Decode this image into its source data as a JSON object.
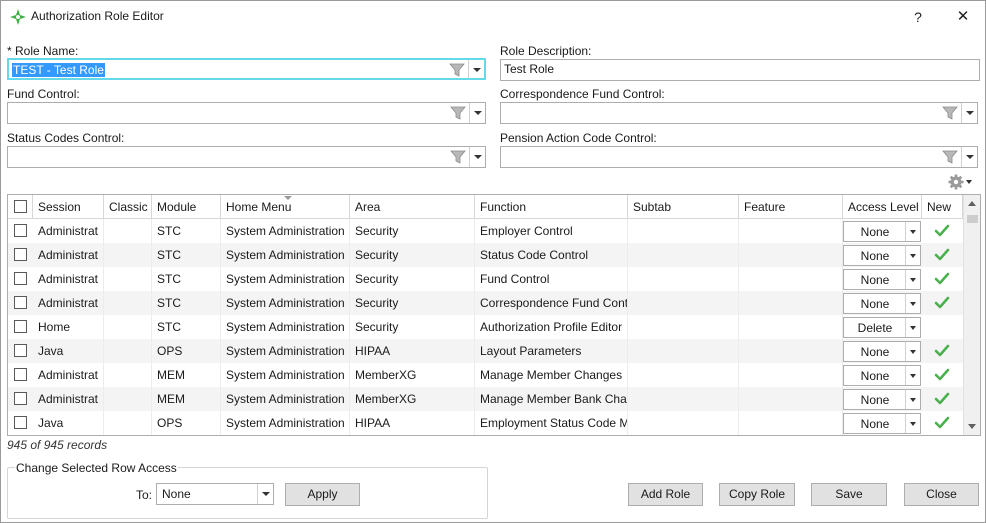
{
  "window": {
    "title": "Authorization Role Editor",
    "help_label": "?",
    "close_label": "✕"
  },
  "form": {
    "role_name_label": "* Role Name:",
    "role_name_value": "TEST - Test Role",
    "role_description_label": "Role Description:",
    "role_description_value": "Test Role",
    "fund_control_label": "Fund Control:",
    "fund_control_value": "",
    "correspondence_fund_control_label": "Correspondence Fund Control:",
    "correspondence_fund_control_value": "",
    "status_codes_control_label": "Status Codes Control:",
    "status_codes_control_value": "",
    "pension_action_code_control_label": "Pension Action Code Control:",
    "pension_action_code_control_value": ""
  },
  "grid": {
    "columns": [
      "Session",
      "Classic",
      "Module",
      "Home Menu",
      "Area",
      "Function",
      "Subtab",
      "Feature",
      "Access Level",
      "New"
    ],
    "rows": [
      {
        "session": "Administrat",
        "classic": "",
        "module": "STC",
        "home_menu": "System Administration",
        "area": "Security",
        "function": "Employer Control",
        "subtab": "",
        "feature": "",
        "access": "None",
        "new": true
      },
      {
        "session": "Administrat",
        "classic": "",
        "module": "STC",
        "home_menu": "System Administration",
        "area": "Security",
        "function": "Status Code Control",
        "subtab": "",
        "feature": "",
        "access": "None",
        "new": true
      },
      {
        "session": "Administrat",
        "classic": "",
        "module": "STC",
        "home_menu": "System Administration",
        "area": "Security",
        "function": "Fund Control",
        "subtab": "",
        "feature": "",
        "access": "None",
        "new": true
      },
      {
        "session": "Administrat",
        "classic": "",
        "module": "STC",
        "home_menu": "System Administration",
        "area": "Security",
        "function": "Correspondence Fund Cont",
        "subtab": "",
        "feature": "",
        "access": "None",
        "new": true
      },
      {
        "session": "Home",
        "classic": "",
        "module": "STC",
        "home_menu": "System Administration",
        "area": "Security",
        "function": "Authorization Profile Editor",
        "subtab": "",
        "feature": "",
        "access": "Delete",
        "new": false
      },
      {
        "session": "Java",
        "classic": "",
        "module": "OPS",
        "home_menu": "System Administration",
        "area": "HIPAA",
        "function": "Layout Parameters",
        "subtab": "",
        "feature": "",
        "access": "None",
        "new": true
      },
      {
        "session": "Administrat",
        "classic": "",
        "module": "MEM",
        "home_menu": "System Administration",
        "area": "MemberXG",
        "function": "Manage Member Changes",
        "subtab": "",
        "feature": "",
        "access": "None",
        "new": true
      },
      {
        "session": "Administrat",
        "classic": "",
        "module": "MEM",
        "home_menu": "System Administration",
        "area": "MemberXG",
        "function": "Manage Member Bank Cha",
        "subtab": "",
        "feature": "",
        "access": "None",
        "new": true
      },
      {
        "session": "Java",
        "classic": "",
        "module": "OPS",
        "home_menu": "System Administration",
        "area": "HIPAA",
        "function": "Employment Status Code M",
        "subtab": "",
        "feature": "",
        "access": "None",
        "new": true
      }
    ],
    "records_text": "945 of 945 records"
  },
  "change_access": {
    "title": "Change Selected Row Access",
    "to_label": "To:",
    "to_value": "None",
    "apply_label": "Apply"
  },
  "buttons": {
    "add_role": "Add Role",
    "copy_role": "Copy Role",
    "save": "Save",
    "close": "Close"
  },
  "colors": {
    "accent": "#66d9e8",
    "selection": "#3399ff",
    "check": "#4caf50",
    "logo": "#3cb043"
  }
}
